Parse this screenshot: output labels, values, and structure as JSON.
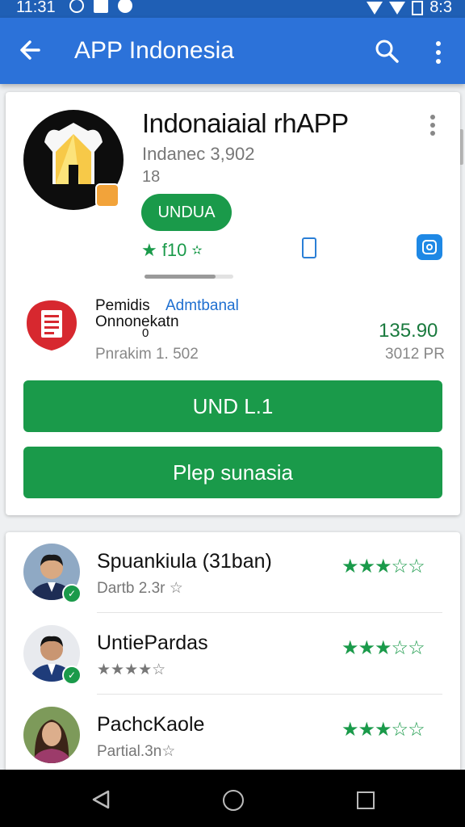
{
  "status_bar": {
    "time": "11:31",
    "battery_text": "8:3"
  },
  "app_bar": {
    "title": "APP Indonesia"
  },
  "app_card": {
    "name": "Indonaiaial rhAPP",
    "developer": "Indanec 3,902",
    "version": "18",
    "install_pill_label": "UNDUA",
    "rating_text": "f10",
    "download_progress_fraction": 0.8,
    "permission_label": "Pemidis",
    "permission_link": "Admtbanal",
    "permission_desc": "Onnonekatn",
    "permission_sub": "0",
    "permission_info": "Pnrakim 1. 502",
    "price": "135.90",
    "price_sub": "3012 PR",
    "primary_button": "UND L.1",
    "secondary_button": "Plep sunasia"
  },
  "reviews": [
    {
      "name": "Spuankiula (31ban)",
      "sub": "Dartb 2.3r ☆",
      "stars_filled": 3,
      "stars_total": 5
    },
    {
      "name": "UntiePardas",
      "sub_stars": "★★★★☆",
      "stars_filled": 3,
      "stars_total": 5
    },
    {
      "name": "PachcKaole",
      "sub": "Partial.3n☆",
      "stars_filled": 3,
      "stars_total": 5
    }
  ],
  "colors": {
    "app_bar": "#2c72d9",
    "status_bar": "#1f5fb5",
    "accent_green": "#1a9a4a"
  }
}
